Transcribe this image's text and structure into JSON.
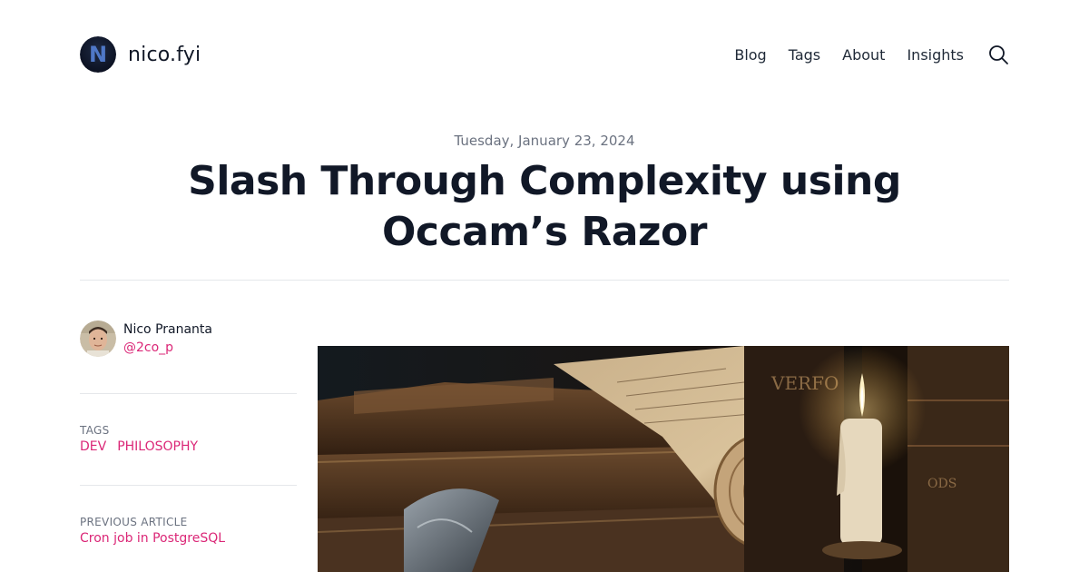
{
  "site": {
    "logo_letter": "N",
    "name": "nico.fyi"
  },
  "nav": {
    "items": [
      {
        "label": "Blog"
      },
      {
        "label": "Tags"
      },
      {
        "label": "About"
      },
      {
        "label": "Insights"
      }
    ],
    "search_icon": "search-icon"
  },
  "post": {
    "date": "Tuesday, January 23, 2024",
    "title": "Slash Through Complexity using Occam’s Razor"
  },
  "sidebar": {
    "author_name": "Nico Prananta",
    "author_handle": "@2co_p",
    "tags_label": "TAGS",
    "tags": [
      "DEV",
      "PHILOSOPHY"
    ],
    "prev_label": "PREVIOUS ARTICLE",
    "prev_title": "Cron job in PostgreSQL"
  },
  "hero": {
    "spine_text_1": "VERFO",
    "spine_text_2": "ODS"
  },
  "colors": {
    "accent": "#db2777",
    "text": "#111827",
    "muted": "#6b7280",
    "divider": "#e5e7eb"
  }
}
